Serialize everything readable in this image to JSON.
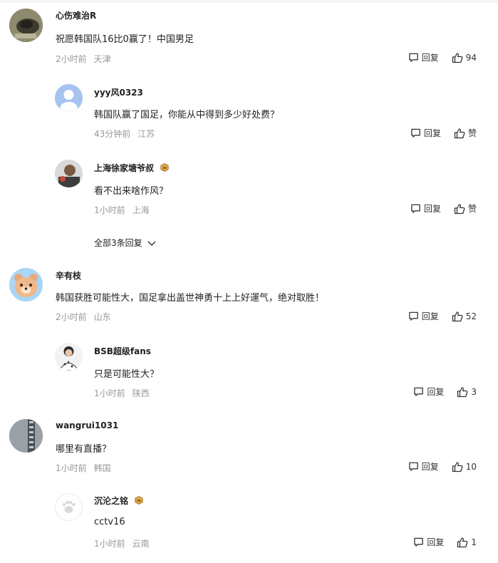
{
  "comments": [
    {
      "name": "心伤难治R",
      "text": "祝愿韩国队16比0赢了！中国男足",
      "time": "2小时前",
      "location": "天津",
      "reply_label": "回复",
      "likes": "94",
      "avatar_icon": "dark-photo-avatar"
    },
    {
      "name": "yyy风0323",
      "text": "韩国队赢了国足，你能从中得到多少好处费？",
      "time": "43分钟前",
      "location": "江苏",
      "reply_label": "回复",
      "likes": "赞",
      "avatar_icon": "default-user-avatar"
    },
    {
      "name": "上海徐家塘爷叔",
      "text": "看不出来啥作风？",
      "time": "1小时前",
      "location": "上海",
      "reply_label": "回复",
      "likes": "赞",
      "avatar_icon": "photo-avatar",
      "badge_icon": "level-badge-icon"
    },
    {
      "name": "辛有枝",
      "text": "韩国获胜可能性大，国足拿出盖世神勇十上上好運气，绝对取胜！",
      "time": "2小时前",
      "location": "山东",
      "reply_label": "回复",
      "likes": "52",
      "avatar_icon": "bear-cartoon-avatar"
    },
    {
      "name": "BSB超级fans",
      "text": "只是可能性大？",
      "time": "1小时前",
      "location": "陕西",
      "reply_label": "回复",
      "likes": "3",
      "avatar_icon": "person-photo-avatar"
    },
    {
      "name": "wangrui1031",
      "text": "哪里有直播？",
      "time": "1小时前",
      "location": "韩国",
      "reply_label": "回复",
      "likes": "10",
      "avatar_icon": "gray-photo-avatar"
    },
    {
      "name": "沉沦之铭",
      "text": "cctv16",
      "time": "1小时前",
      "location": "云南",
      "reply_label": "回复",
      "likes": "1",
      "avatar_icon": "paw-default-avatar",
      "badge_icon": "level-badge-icon"
    }
  ],
  "expand_replies_label": "全部3条回复",
  "colors": {
    "name": "#222222",
    "meta": "#999999",
    "avatar_default": "#a7c4f0"
  }
}
